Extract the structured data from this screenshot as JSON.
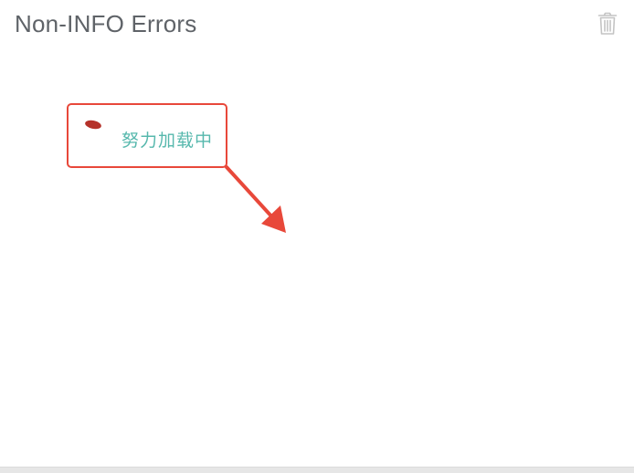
{
  "panel": {
    "title": "Non-INFO Errors",
    "delete_icon": "trash-icon"
  },
  "loading": {
    "text": "努力加载中",
    "spinner_icon": "loading-spinner-icon"
  },
  "annotation": {
    "box_color": "#e8483a",
    "arrow_color": "#e8483a"
  },
  "colors": {
    "title": "#5f6368",
    "loading_text": "#57b8ad",
    "spinner": "#b5322a",
    "icon": "#c4c4c4"
  }
}
